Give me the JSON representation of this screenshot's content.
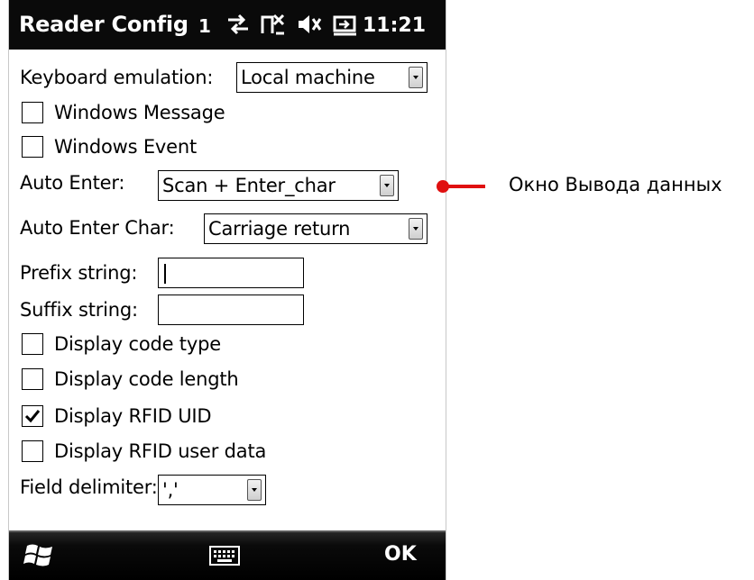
{
  "titlebar": {
    "title": "Reader Config",
    "notification_count": "1",
    "connection_icon": "sync-arrows-icon",
    "signal_icon": "no-signal-icon",
    "volume_icon": "speaker-off-icon",
    "battery_icon": "battery-charging-icon",
    "clock": "11:21"
  },
  "form": {
    "keyboard_emulation": {
      "label": "Keyboard emulation:",
      "value": "Local machine"
    },
    "windows_message": {
      "label": "Windows Message",
      "checked": false
    },
    "windows_event": {
      "label": "Windows Event",
      "checked": false
    },
    "auto_enter": {
      "label": "Auto Enter:",
      "value": "Scan + Enter_char"
    },
    "auto_enter_char": {
      "label": "Auto Enter Char:",
      "value": "Carriage return"
    },
    "prefix": {
      "label": "Prefix string:",
      "value": ""
    },
    "suffix": {
      "label": "Suffix string:",
      "value": ""
    },
    "display_code_type": {
      "label": "Display code type",
      "checked": false
    },
    "display_code_length": {
      "label": "Display code length",
      "checked": false
    },
    "display_rfid_uid": {
      "label": "Display RFID UID",
      "checked": true
    },
    "display_rfid_user_data": {
      "label": "Display RFID user data",
      "checked": false
    },
    "field_delimiter": {
      "label": "Field delimiter:",
      "value": "','"
    }
  },
  "softbar": {
    "start_icon": "windows-flag-icon",
    "keyboard_icon": "keyboard-icon",
    "ok_label": "OK"
  },
  "callout": {
    "text": "Окно Вывода данных",
    "color": "#e01010"
  }
}
